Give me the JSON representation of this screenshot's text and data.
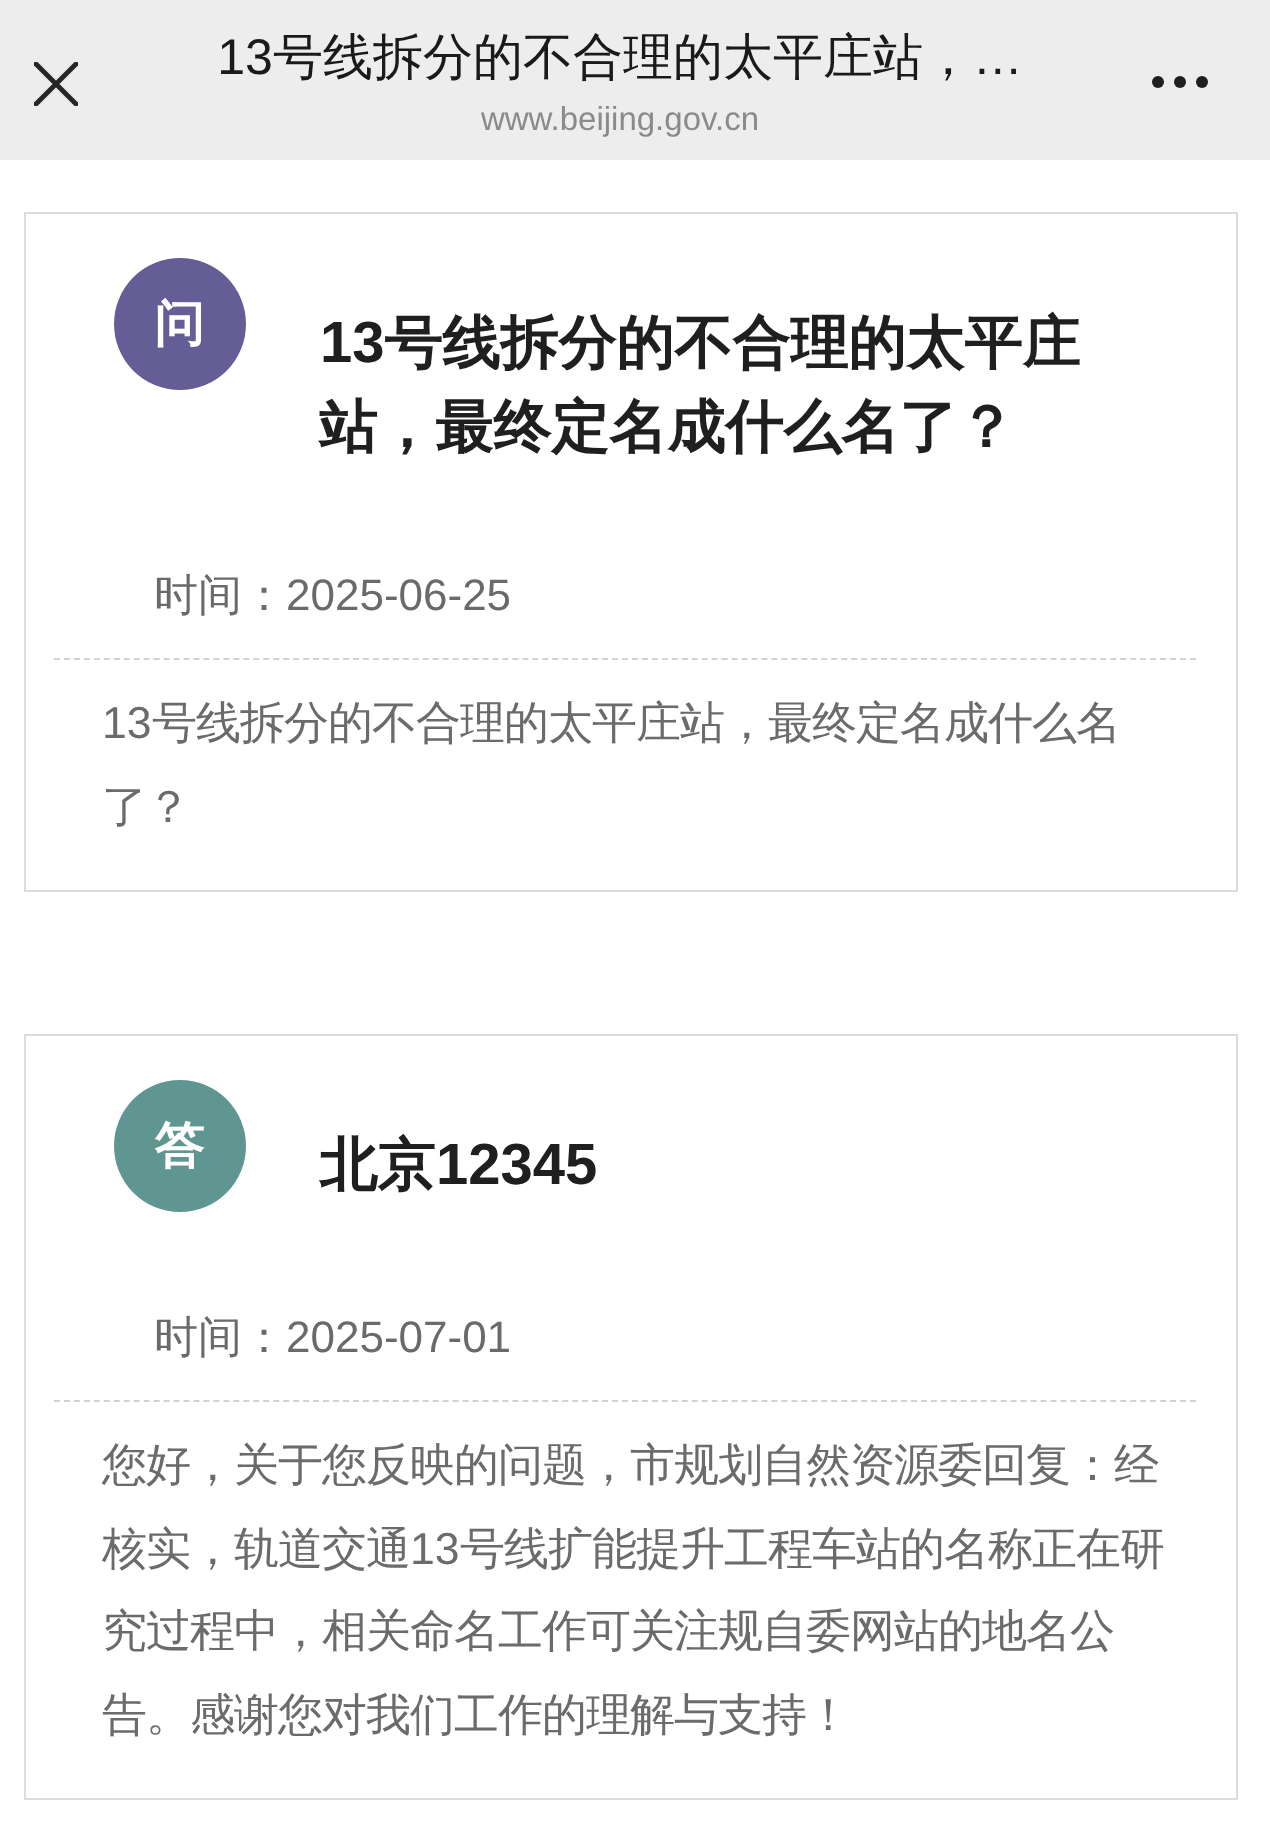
{
  "header": {
    "title": "13号线拆分的不合理的太平庄站，…",
    "url": "www.beijing.gov.cn"
  },
  "cards": [
    {
      "avatar": "问",
      "color": "#655d96",
      "heading": "13号线拆分的不合理的太平庄站，最终定名成什么名了？",
      "time": "时间：2025-06-25",
      "body": "13号线拆分的不合理的太平庄站，最终定名成什么名了？"
    },
    {
      "avatar": "答",
      "color": "#5f9691",
      "heading": "北京12345",
      "time": "时间：2025-07-01",
      "body": "您好，关于您反映的问题，市规划自然资源委回复：经核实，轨道交通13号线扩能提升工程车站的名称正在研究过程中，相关命名工作可关注规自委网站的地名公告。感谢您对我们工作的理解与支持！"
    }
  ]
}
